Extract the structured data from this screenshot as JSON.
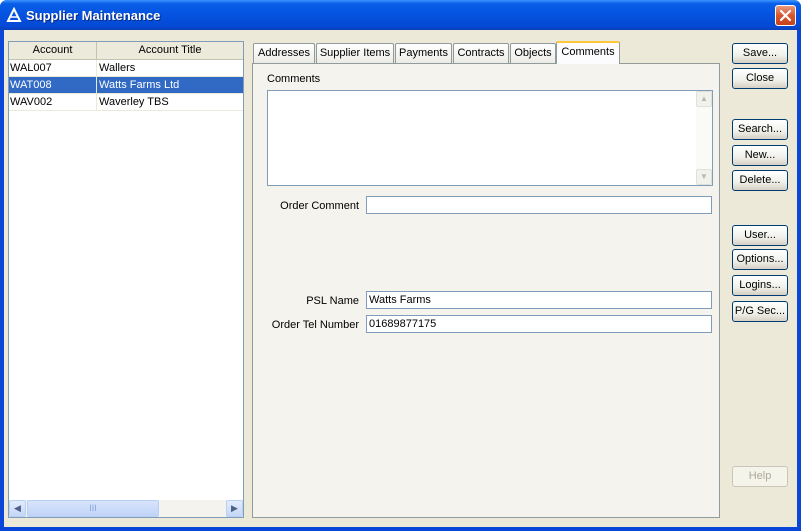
{
  "window": {
    "title": "Supplier Maintenance"
  },
  "list": {
    "columns": [
      "Account",
      "Account Title"
    ],
    "rows": [
      {
        "account": "WAL007",
        "title": "Wallers",
        "selected": false
      },
      {
        "account": "WAT008",
        "title": "Watts Farms Ltd",
        "selected": true
      },
      {
        "account": "WAV002",
        "title": "Waverley TBS",
        "selected": false
      }
    ],
    "scroll_grip": "III"
  },
  "tabs": [
    {
      "label": "Addresses",
      "active": false
    },
    {
      "label": "Supplier Items",
      "active": false
    },
    {
      "label": "Payments",
      "active": false
    },
    {
      "label": "Contracts",
      "active": false
    },
    {
      "label": "Objects",
      "active": false
    },
    {
      "label": "Comments",
      "active": true
    }
  ],
  "comments": {
    "comments_label": "Comments",
    "comments_value": "",
    "order_comment_label": "Order Comment",
    "order_comment_value": "",
    "psl_name_label": "PSL Name",
    "psl_name_value": "Watts Farms",
    "order_tel_label": "Order Tel Number",
    "order_tel_value": "01689877175"
  },
  "buttons": {
    "save": "Save...",
    "close": "Close",
    "search": "Search...",
    "new": "New...",
    "delete": "Delete...",
    "user": "User...",
    "options": "Options...",
    "logins": "Logins...",
    "pg_sec": "P/G Sec...",
    "help": "Help"
  },
  "colors": {
    "selection": "#316ac5",
    "titlebar": "#0453e0",
    "active_tab_accent": "#ffc83c"
  }
}
